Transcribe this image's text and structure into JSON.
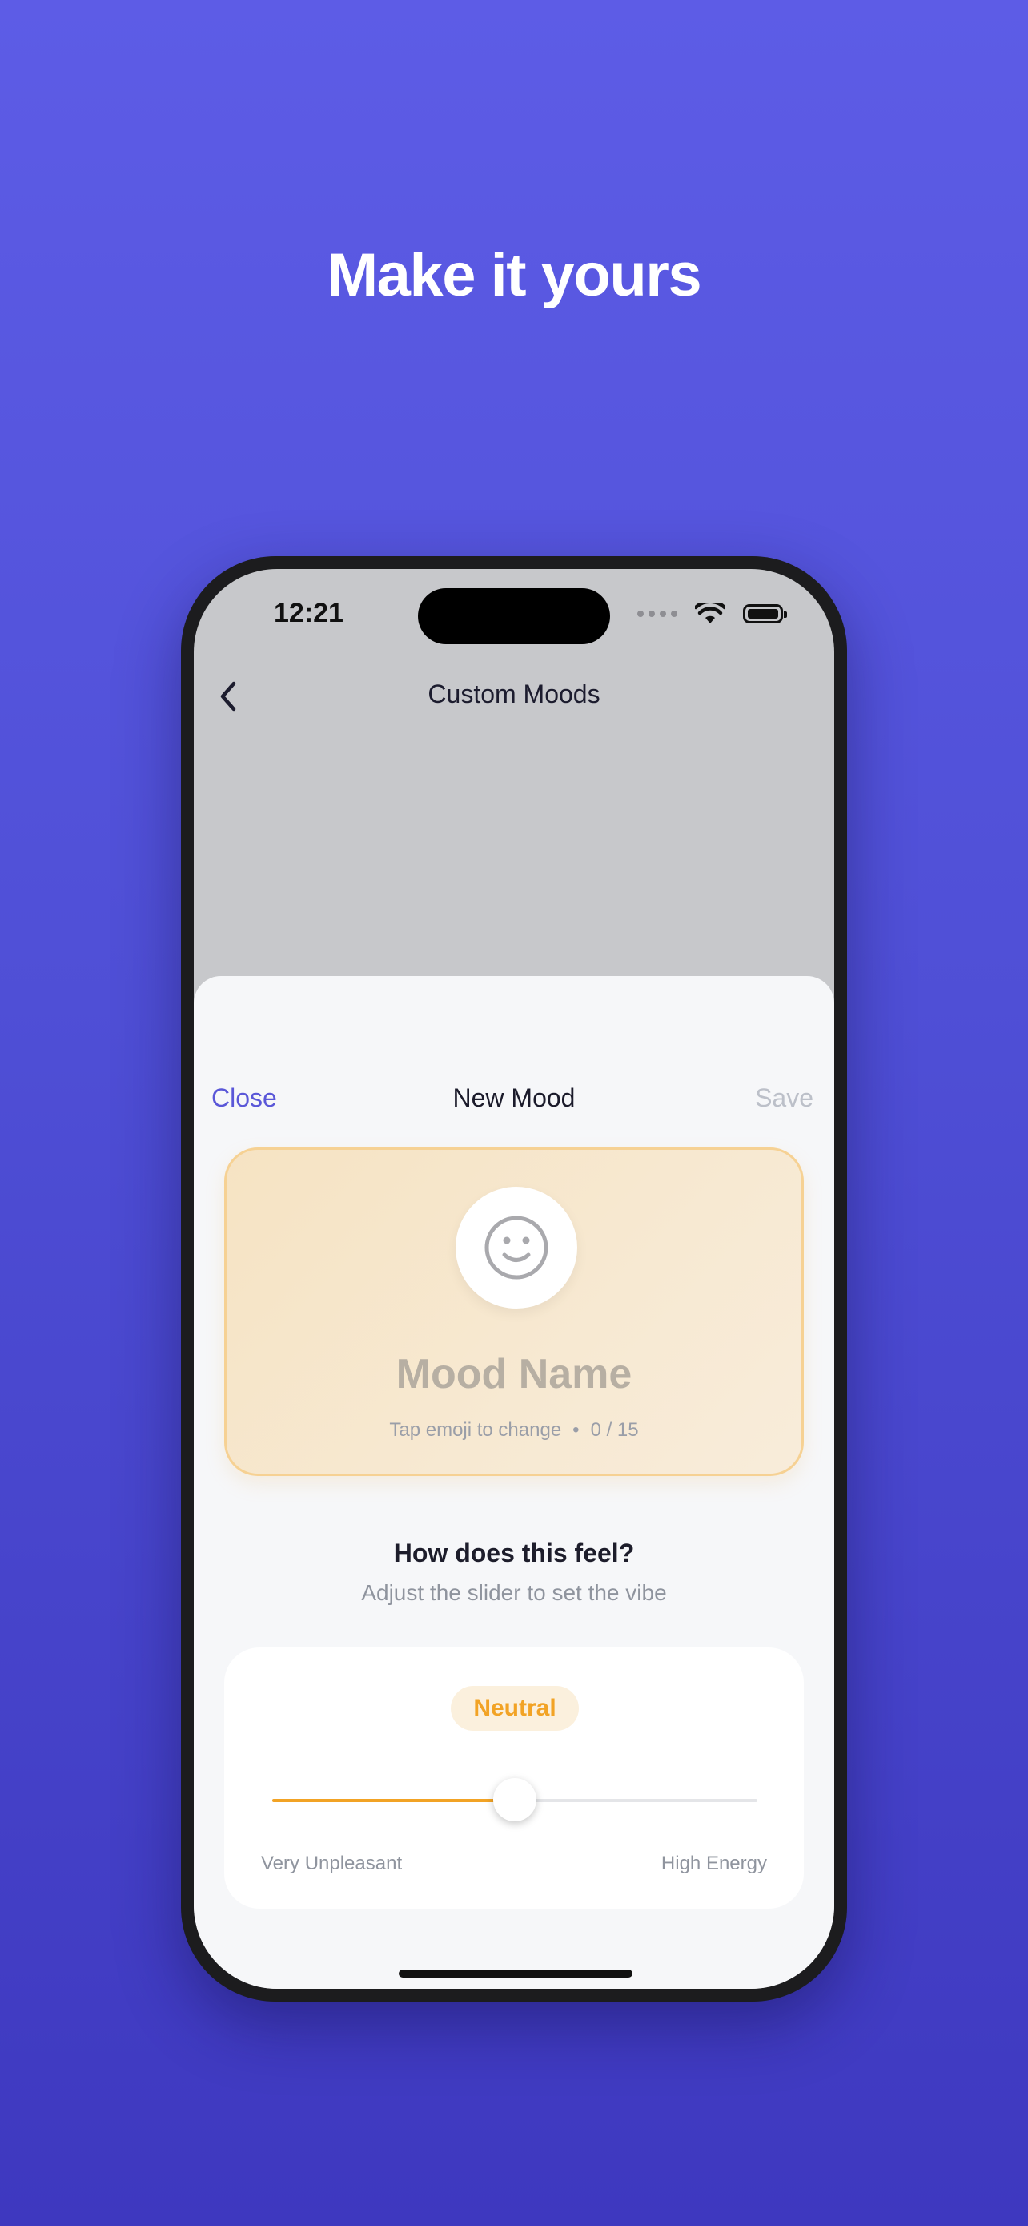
{
  "headline": "Make it yours",
  "status_bar": {
    "time": "12:21"
  },
  "nav": {
    "title": "Custom Moods"
  },
  "sheet": {
    "close_label": "Close",
    "title": "New Mood",
    "save_label": "Save",
    "mood_card": {
      "name_placeholder": "Mood Name",
      "hint": "Tap emoji to change",
      "separator": "•",
      "char_count": "0 / 15",
      "emoji_icon": "smiley-face-icon"
    },
    "question": {
      "title": "How does this feel?",
      "subtitle": "Adjust the slider to set the vibe"
    },
    "slider": {
      "value_label": "Neutral",
      "value": 0.5,
      "min_label": "Very Unpleasant",
      "max_label": "High Energy"
    }
  },
  "colors": {
    "accent": "#5a57d8",
    "slider_accent": "#f2a325",
    "background_top": "#5d5ce6",
    "background_bottom": "#3e38bf"
  }
}
